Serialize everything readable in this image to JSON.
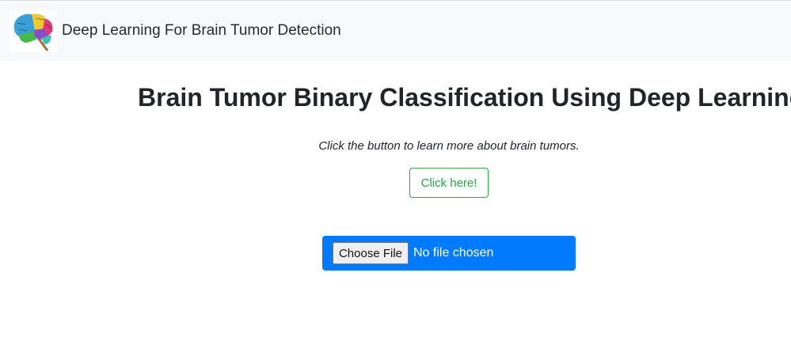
{
  "navbar": {
    "logo_icon": "brain-icon",
    "title": "Deep Learning For Brain Tumor Detection"
  },
  "main": {
    "title": "Brain Tumor Binary Classification Using Deep Learning",
    "subtitle": "Click the button to learn more about brain tumors.",
    "learn_button_label": "Click here!"
  },
  "upload": {
    "choose_button_label": "Choose File",
    "status_text": "No file chosen"
  },
  "colors": {
    "navbar_bg": "#f8f9fa",
    "success_green": "#28a745",
    "primary_blue": "#007bff"
  }
}
